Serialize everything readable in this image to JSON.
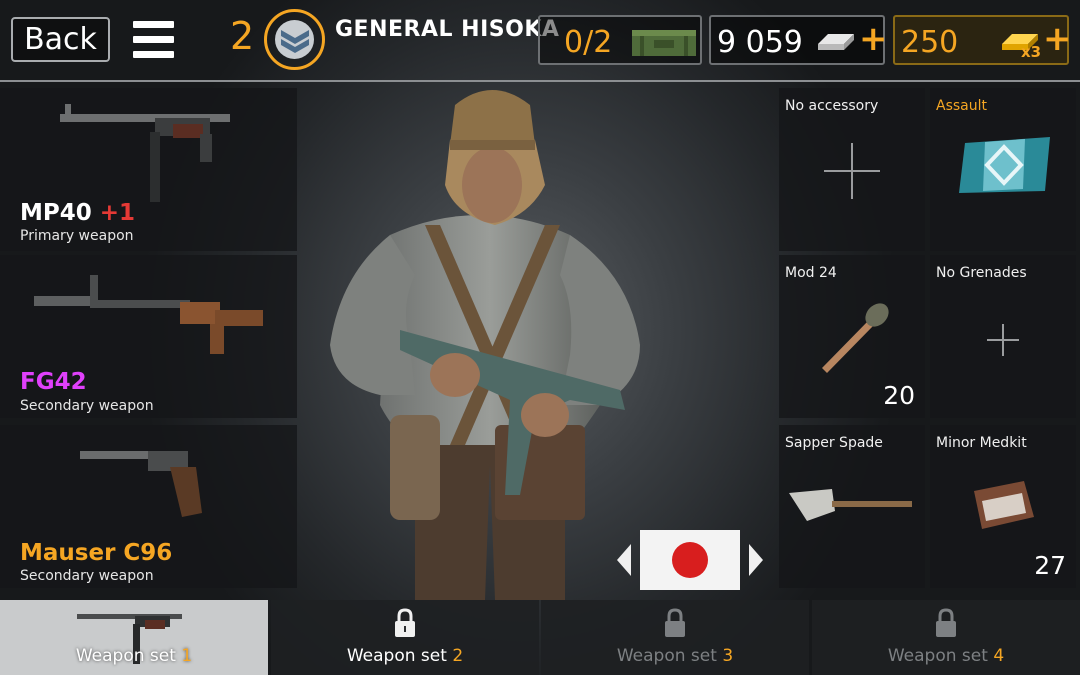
{
  "topbar": {
    "back_label": "Back",
    "rank_number": "2",
    "player_name": "GENERAL HISOKA",
    "crates": "0/2",
    "silver": "9 059",
    "gold": "250",
    "gold_multiplier": "x3"
  },
  "weapons": [
    {
      "name": "MP40",
      "bonus": "+1",
      "slot": "Primary weapon",
      "name_color": "#ffffff"
    },
    {
      "name": "FG42",
      "bonus": "",
      "slot": "Secondary weapon",
      "name_color": "#e040fb"
    },
    {
      "name": "Mauser C96",
      "bonus": "",
      "slot": "Secondary weapon",
      "name_color": "#f5a623"
    }
  ],
  "items": {
    "accessory": {
      "label": "No accessory"
    },
    "class": {
      "label": "Assault"
    },
    "grenade_primary": {
      "label": "Mod 24",
      "count": "20"
    },
    "grenade_secondary": {
      "label": "No Grenades"
    },
    "tool": {
      "label": "Sapper Spade"
    },
    "medkit": {
      "label": "Minor Medkit",
      "count": "27"
    }
  },
  "tabs": [
    {
      "label": "Weapon set",
      "num": "1"
    },
    {
      "label": "Weapon set",
      "num": "2"
    },
    {
      "label": "Weapon set",
      "num": "3"
    },
    {
      "label": "Weapon set",
      "num": "4"
    }
  ],
  "colors": {
    "accent": "#f5a623",
    "fg42": "#e040fb",
    "red": "#e53935"
  }
}
